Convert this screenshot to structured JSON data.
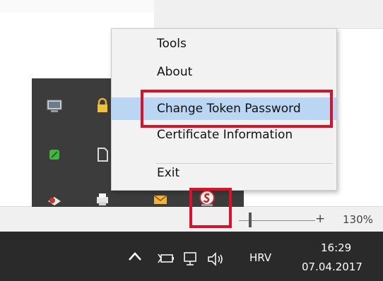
{
  "context_menu": {
    "items": [
      {
        "label": "Tools"
      },
      {
        "label": "About"
      },
      {
        "label": "Change Token Password",
        "highlighted": true
      },
      {
        "label": "Certificate Information"
      },
      {
        "label": "Exit"
      }
    ]
  },
  "zoom": {
    "plus": "+",
    "percent": "130%",
    "level": 0.14
  },
  "taskbar": {
    "show_hidden_icons": "^",
    "language": "HRV",
    "time": "16:29",
    "date": "07.04.2017"
  },
  "tray_icons": [
    "monitor-icon",
    "lock-icon",
    "green-leaf-icon",
    "file-icon",
    "cloud-icon",
    "printer-icon",
    "mail-icon",
    "token-app-icon"
  ],
  "colors": {
    "menu_highlight": "#bad6f2",
    "annotation_red": "#d5142b",
    "taskbar": "#2a2a2a",
    "flyout": "#3c3c3c"
  }
}
